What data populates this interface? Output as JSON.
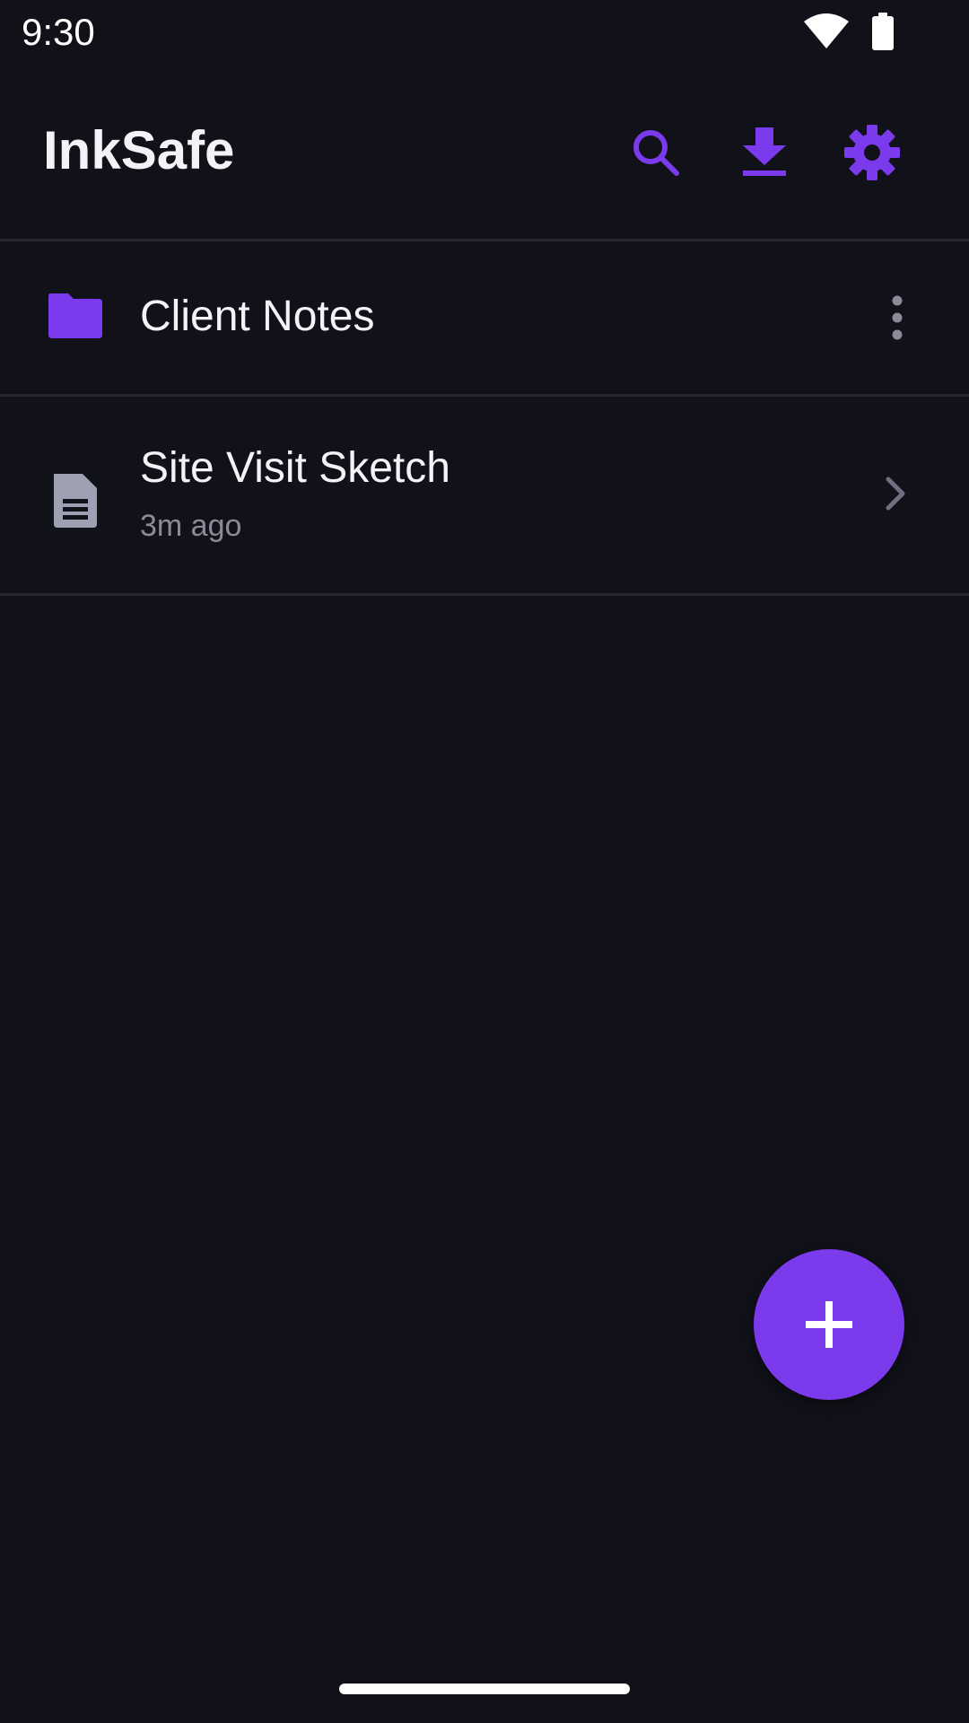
{
  "status_bar": {
    "time": "9:30",
    "wifi_icon": "wifi-icon",
    "battery_icon": "battery-icon"
  },
  "app_bar": {
    "title": "InkSafe",
    "actions": [
      {
        "icon": "search-icon"
      },
      {
        "icon": "download-icon"
      },
      {
        "icon": "gear-icon"
      }
    ]
  },
  "list": {
    "items": [
      {
        "type": "folder",
        "title": "Client Notes",
        "icon": "folder-icon",
        "trailing": "more-vert-icon"
      },
      {
        "type": "file",
        "title": "Site Visit Sketch",
        "subtitle": "3m ago",
        "icon": "document-icon",
        "trailing": "chevron-right-icon"
      }
    ]
  },
  "fab": {
    "icon": "plus-icon"
  },
  "colors": {
    "background": "#11111a",
    "accent": "#7c3aed",
    "text_primary": "#f2f2f7",
    "text_secondary": "#8a8a99",
    "divider": "#262632",
    "icon_muted": "#9ca0b0"
  }
}
